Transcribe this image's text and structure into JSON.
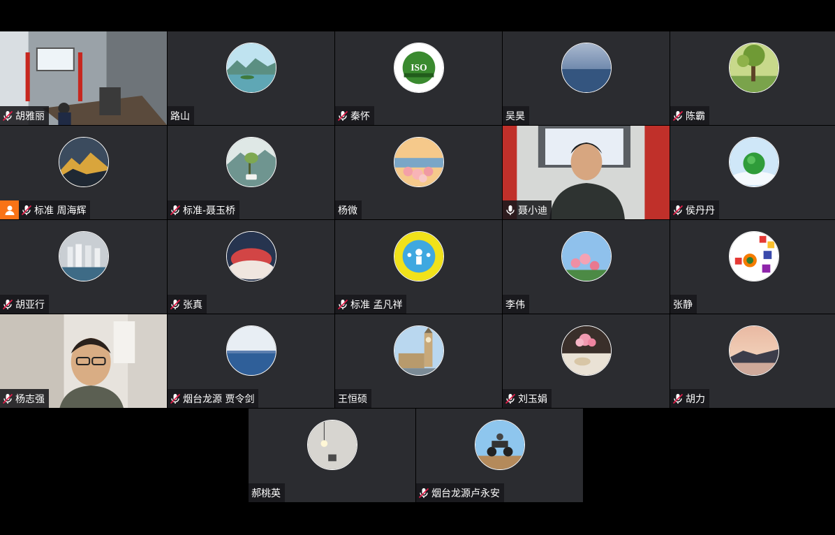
{
  "participants": [
    {
      "name": "胡雅丽",
      "muted": true,
      "kind": "video",
      "scene": "office"
    },
    {
      "name": "路山",
      "muted": false,
      "kind": "avatar",
      "avatar": "lake-landscape-icon"
    },
    {
      "name": "秦怀",
      "muted": true,
      "kind": "avatar",
      "avatar": "iso-certification-icon"
    },
    {
      "name": "吴昊",
      "muted": false,
      "kind": "avatar",
      "avatar": "blue-sky-icon"
    },
    {
      "name": "陈霸",
      "muted": true,
      "kind": "avatar",
      "avatar": "tree-landscape-icon"
    },
    {
      "name": "标准  周海辉",
      "muted": true,
      "kind": "avatar",
      "avatar": "golden-mountain-icon",
      "host": true
    },
    {
      "name": "标准-聂玉桥",
      "muted": true,
      "kind": "avatar",
      "avatar": "bonsai-mountain-icon"
    },
    {
      "name": "杨微",
      "muted": false,
      "kind": "avatar",
      "avatar": "tulip-flowers-icon"
    },
    {
      "name": "聂小迪",
      "muted": false,
      "kind": "video",
      "scene": "young-man-headset",
      "speaking": true
    },
    {
      "name": "侯丹丹",
      "muted": true,
      "kind": "avatar",
      "avatar": "green-planet-icon"
    },
    {
      "name": "胡亚行",
      "muted": true,
      "kind": "avatar",
      "avatar": "city-towers-icon"
    },
    {
      "name": "张真",
      "muted": true,
      "kind": "avatar",
      "avatar": "red-cloud-icon"
    },
    {
      "name": "标准 孟凡祥",
      "muted": true,
      "kind": "avatar",
      "avatar": "people-circle-icon"
    },
    {
      "name": "李伟",
      "muted": false,
      "kind": "avatar",
      "avatar": "pink-flowers-icon"
    },
    {
      "name": "张静",
      "muted": false,
      "kind": "avatar",
      "avatar": "colorful-mosaic-icon"
    },
    {
      "name": "杨志强",
      "muted": true,
      "kind": "video",
      "scene": "man-glasses"
    },
    {
      "name": "烟台龙源 贾令剑",
      "muted": true,
      "kind": "avatar",
      "avatar": "sea-horizon-icon"
    },
    {
      "name": "王恒硕",
      "muted": false,
      "kind": "avatar",
      "avatar": "big-ben-icon"
    },
    {
      "name": "刘玉娟",
      "muted": true,
      "kind": "avatar",
      "avatar": "flower-vase-icon"
    },
    {
      "name": "胡力",
      "muted": true,
      "kind": "avatar",
      "avatar": "sunset-mountain-icon"
    },
    {
      "name": "郝桃英",
      "muted": false,
      "kind": "avatar",
      "avatar": "pendant-lamp-icon"
    },
    {
      "name": "烟台龙源卢永安",
      "muted": true,
      "kind": "avatar",
      "avatar": "atv-rider-icon"
    }
  ],
  "colors": {
    "tile": "#2b2c30",
    "active_border": "#22c55e",
    "host_badge": "#f97316"
  }
}
